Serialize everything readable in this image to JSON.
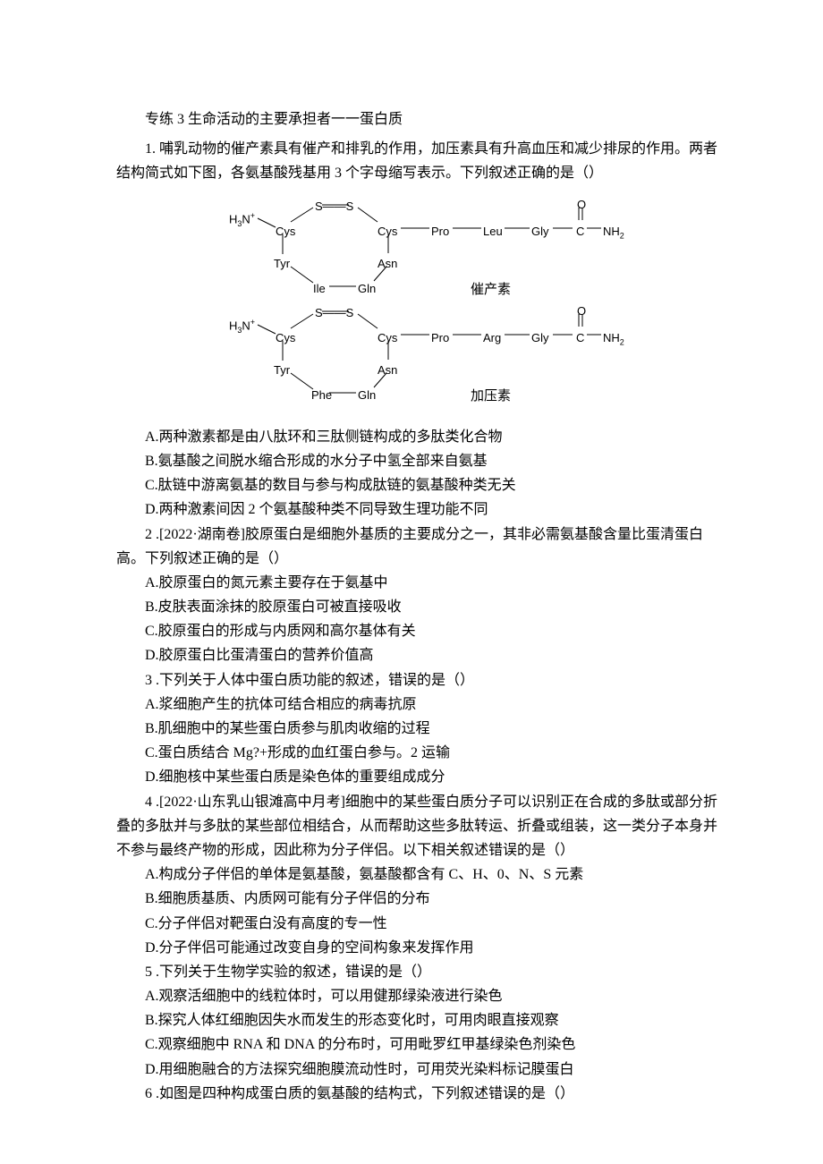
{
  "title": "专练 3 生命活动的主要承担者一一蛋白质",
  "q1": {
    "stem": "1. 哺乳动物的催产素具有催产和排乳的作用，加压素具有升高血压和减少排尿的作用。两者结构简式如下图，各氨基酸残基用 3 个字母缩写表示。下列叙述正确的是（）",
    "diagram": {
      "left_end": "H₃N",
      "right_frag_O": "O",
      "right_frag_C": "C",
      "right_frag_NH2": "NH₂",
      "mol1": {
        "ring": [
          "Cys",
          "Tyr",
          "Ile",
          "Gln",
          "Asn",
          "Cys"
        ],
        "chain": [
          "Pro",
          "Leu",
          "Gly"
        ],
        "bridge": "S——S",
        "label": "催产素"
      },
      "mol2": {
        "ring": [
          "Cys",
          "Tyr",
          "Phe",
          "Gln",
          "Asn",
          "Cys"
        ],
        "chain": [
          "Pro",
          "Arg",
          "Gly"
        ],
        "bridge": "S——S",
        "label": "加压素"
      }
    },
    "A": "A.两种激素都是由八肽环和三肽侧链构成的多肽类化合物",
    "B": "B.氨基酸之间脱水缩合形成的水分子中氢全部来自氨基",
    "C": "C.肽链中游离氨基的数目与参与构成肽链的氨基酸种类无关",
    "D": "D.两种激素间因 2 个氨基酸种类不同导致生理功能不同"
  },
  "q2": {
    "stem": "2 .[2022·湖南卷]胶原蛋白是细胞外基质的主要成分之一，其非必需氨基酸含量比蛋清蛋白高。下列叙述正确的是（）",
    "A": "A.胶原蛋白的氮元素主要存在于氨基中",
    "B": "B.皮肤表面涂抹的胶原蛋白可被直接吸收",
    "C": "C.胶原蛋白的形成与内质网和高尔基体有关",
    "D": "D.胶原蛋白比蛋清蛋白的营养价值高"
  },
  "q3": {
    "stem": "3 .下列关于人体中蛋白质功能的叙述，错误的是（）",
    "A": "A.浆细胞产生的抗体可结合相应的病毒抗原",
    "B": "B.肌细胞中的某些蛋白质参与肌肉收缩的过程",
    "C": "C.蛋白质结合 Mg?+形成的血红蛋白参与。2 运输",
    "D": "D.细胞核中某些蛋白质是染色体的重要组成成分"
  },
  "q4": {
    "stem": "4 .[2022·山东乳山银滩高中月考]细胞中的某些蛋白质分子可以识别正在合成的多肽或部分折叠的多肽并与多肽的某些部位相结合，从而帮助这些多肽转运、折叠或组装，这一类分子本身并不参与最终产物的形成，因此称为分子伴侣。以下相关叙述错误的是（）",
    "A": "A.构成分子伴侣的单体是氨基酸，氨基酸都含有 C、H、0、N、S 元素",
    "B": "B.细胞质基质、内质网可能有分子伴侣的分布",
    "C": "C.分子伴侣对靶蛋白没有高度的专一性",
    "D": "D.分子伴侣可能通过改变自身的空间构象来发挥作用"
  },
  "q5": {
    "stem": "5 .下列关于生物学实验的叙述，错误的是（）",
    "A": "A.观察活细胞中的线粒体时，可以用健那绿染液进行染色",
    "B": "B.探究人体红细胞因失水而发生的形态变化时，可用肉眼直接观察",
    "C": "C.观察细胞中 RNA 和 DNA 的分布时，可用毗罗红甲基绿染色剂染色",
    "D": "D.用细胞融合的方法探究细胞膜流动性时，可用荧光染料标记膜蛋白"
  },
  "q6": {
    "stem": "6 .如图是四种构成蛋白质的氨基酸的结构式，下列叙述错误的是（）"
  }
}
